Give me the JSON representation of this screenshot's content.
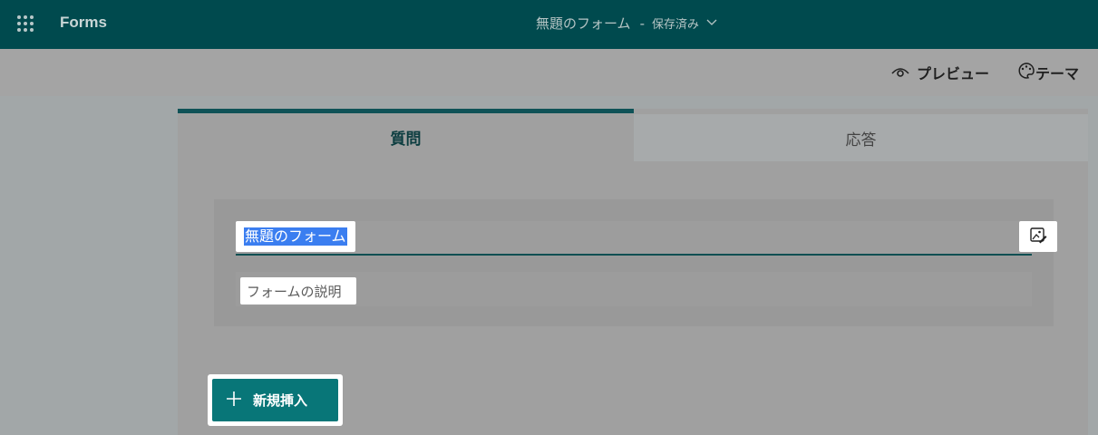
{
  "header": {
    "app_name": "Forms",
    "doc_title": "無題のフォーム",
    "separator": "-",
    "save_status": "保存済み",
    "bg_color": "#004a4e"
  },
  "commands": {
    "preview_label": "プレビュー",
    "theme_label": "テーマ"
  },
  "tabs": {
    "questions": "質問",
    "responses": "応答",
    "active": "questions"
  },
  "form": {
    "title_value": "無題のフォーム",
    "description_placeholder": "フォームの説明"
  },
  "actions": {
    "insert_label": "新規挿入"
  },
  "colors": {
    "accent": "#087678",
    "selection": "#3b7ef0"
  }
}
